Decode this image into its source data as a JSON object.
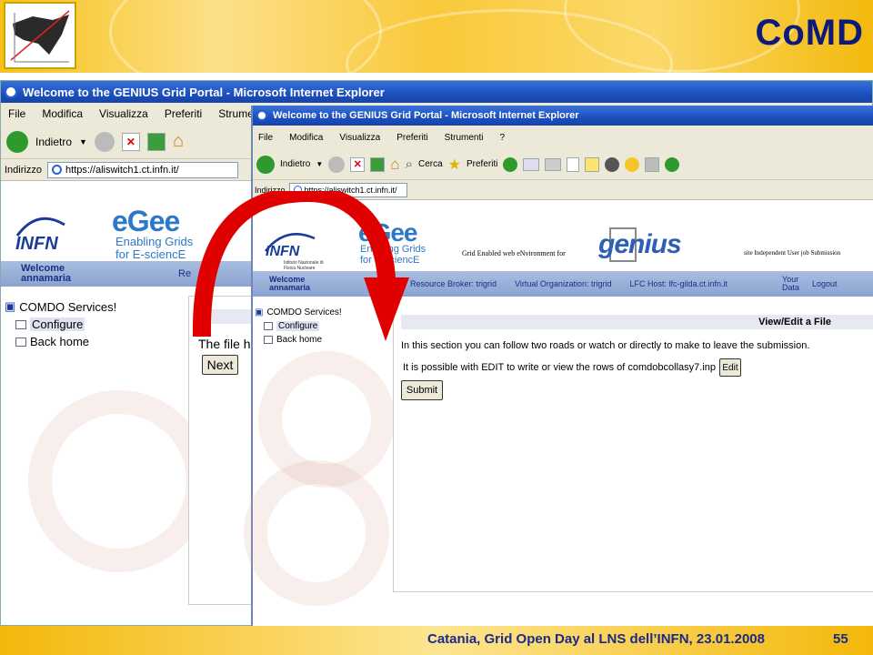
{
  "slide": {
    "title": "CoMD",
    "footer": "Catania, Grid Open Day al LNS dell’INFN, 23.01.2008",
    "page_number": "55"
  },
  "back_window": {
    "title": "Welcome to the GENIUS Grid Portal - Microsoft Internet Explorer",
    "menu": [
      "File",
      "Modifica",
      "Visualizza",
      "Preferiti",
      "Strumenti"
    ],
    "toolbar_back_label": "Indietro",
    "address_label": "Indirizzo",
    "address": "https://aliswitch1.ct.infn.it/",
    "welcome_line1": "Welcome",
    "welcome_line2": "annamaria",
    "nav_partial": "Re",
    "infn_label": "INFN",
    "egee_logo": "eGee",
    "egee_tag1": "Enabling Grids",
    "egee_tag2": "for E-sciencE",
    "tree_root": "COMDO Services!",
    "tree_items": [
      "Configure",
      "Back home"
    ],
    "content_text": "The file h",
    "next_button": "Next"
  },
  "front_window": {
    "title": "Welcome to the GENIUS Grid Portal - Microsoft Internet Explorer",
    "menu": [
      "File",
      "Modifica",
      "Visualizza",
      "Preferiti",
      "Strumenti",
      "?"
    ],
    "toolbar_back_label": "Indietro",
    "toolbar_search_label": "Cerca",
    "toolbar_favorites_label": "Preferiti",
    "address_label": "Indirizzo",
    "address": "https://aliswitch1.ct.infn.it/",
    "infn_label": "INFN",
    "infn_sub": "Istituto Nazionale di Fisica Nucleare",
    "egee_logo": "eGee",
    "egee_tag1": "Enabling Grids",
    "egee_tag2": "for E-sciencE",
    "genius_tagline": "Grid Enabled web eNvironment for",
    "genius_logo": "genius",
    "genius_tagline2": "site Independent User job Submission",
    "welcome_line1": "Welcome",
    "welcome_line2": "annamaria",
    "nav": {
      "resource_broker": "Resource Broker: trigrid",
      "virtual_org": "Virtual Organization: trigrid",
      "lfc_host": "LFC Host: lfc-gilda.ct.infn.it",
      "your_data_1": "Your",
      "your_data_2": "Data",
      "logout": "Logout"
    },
    "tree_root": "COMDO Services!",
    "tree_items": [
      "Configure",
      "Back home"
    ],
    "section_header": "View/Edit a File",
    "intro_text": "In this section you can follow two roads or watch or directly to make to leave the submission.",
    "edit_text": "It is possible with EDIT to write or view the rows of comdobcollasy7.inp",
    "edit_button": "Edit",
    "submit_button": "Submit"
  },
  "colors": {
    "title_text": "#0e1a7a",
    "titlebar": "#1b4fbf",
    "nav_strip": "#8aa3d1",
    "arrow": "#e00000"
  }
}
